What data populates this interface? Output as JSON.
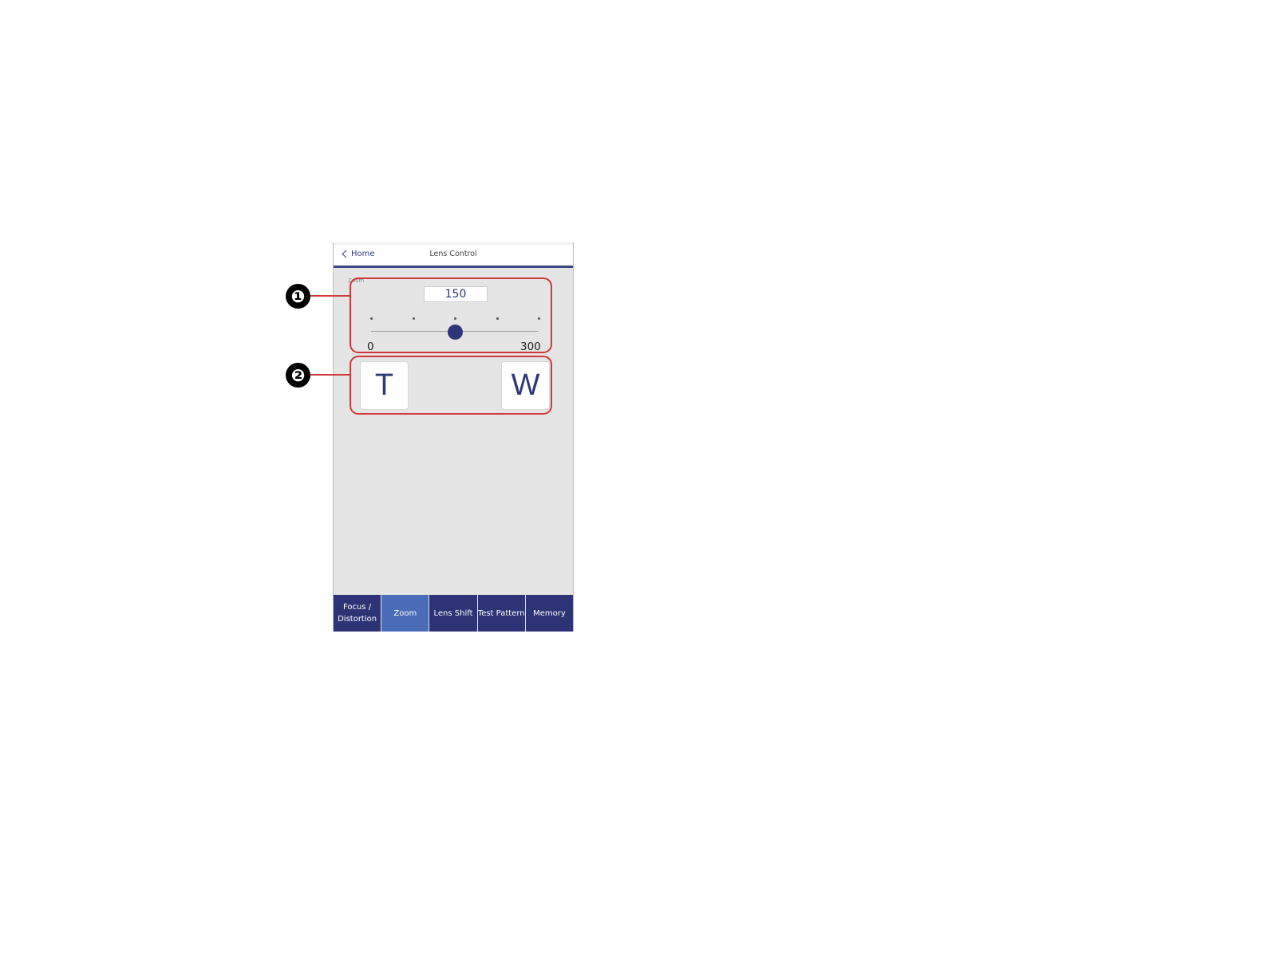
{
  "header": {
    "back_label": "Home",
    "title": "Lens Control"
  },
  "zoom": {
    "section_label": "Zoom",
    "value": "150",
    "min_label": "0",
    "max_label": "300",
    "min": 0,
    "max": 300,
    "current": 150,
    "tick_count": 5,
    "tele_label": "T",
    "wide_label": "W"
  },
  "tabs": [
    {
      "label": "Focus /\nDistortion",
      "active": false
    },
    {
      "label": "Zoom",
      "active": true
    },
    {
      "label": "Lens Shift",
      "active": false
    },
    {
      "label": "Test Pattern",
      "active": false
    },
    {
      "label": "Memory",
      "active": false
    }
  ],
  "callouts": {
    "one": "❶",
    "two": "❷"
  },
  "colors": {
    "accent": "#2d3374",
    "active_tab": "#4a6bb8",
    "callout_red": "#cf3a3a"
  }
}
